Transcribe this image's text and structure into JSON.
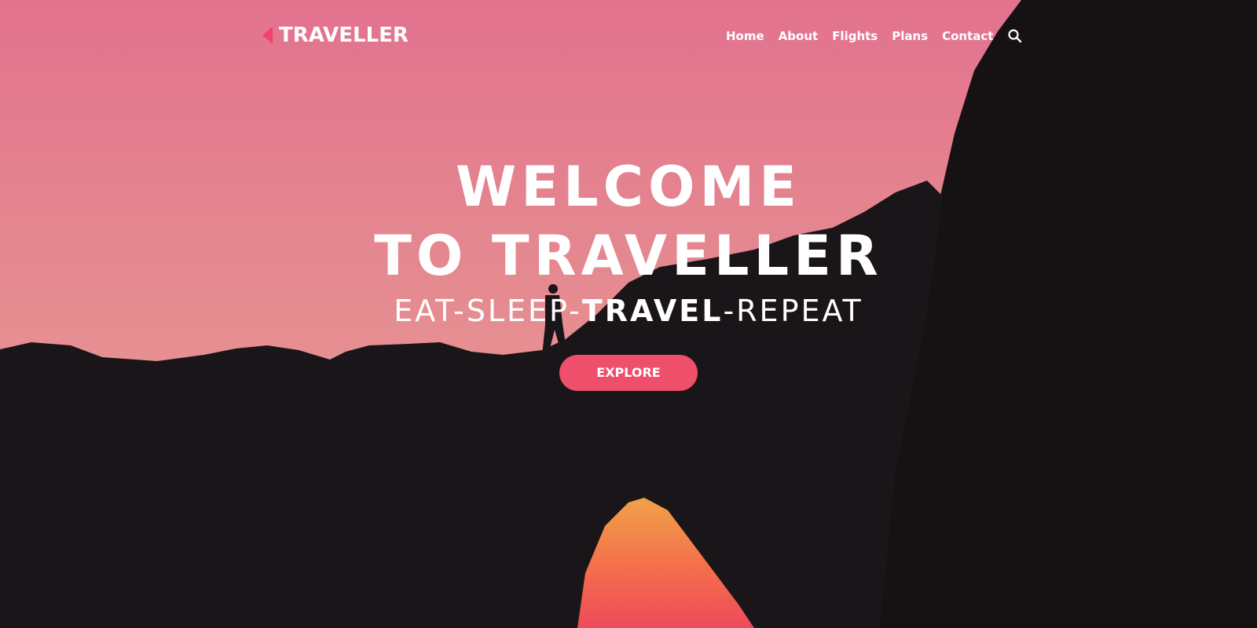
{
  "brand": {
    "name": "TRAVELLER",
    "accent_color": "#f0426b"
  },
  "nav": {
    "items": [
      {
        "label": "Home"
      },
      {
        "label": "About"
      },
      {
        "label": "Flights"
      },
      {
        "label": "Plans"
      },
      {
        "label": "Contact"
      }
    ],
    "search_icon": "search-icon"
  },
  "hero": {
    "title_line_1": "WELCOME",
    "title_line_2": "TO TRAVELLER",
    "tagline_prefix": "EAT-SLEEP-",
    "tagline_strong": "TRAVEL",
    "tagline_suffix": "-REPEAT",
    "cta_label": "EXPLORE",
    "cta_color": "#ee4f6a"
  }
}
